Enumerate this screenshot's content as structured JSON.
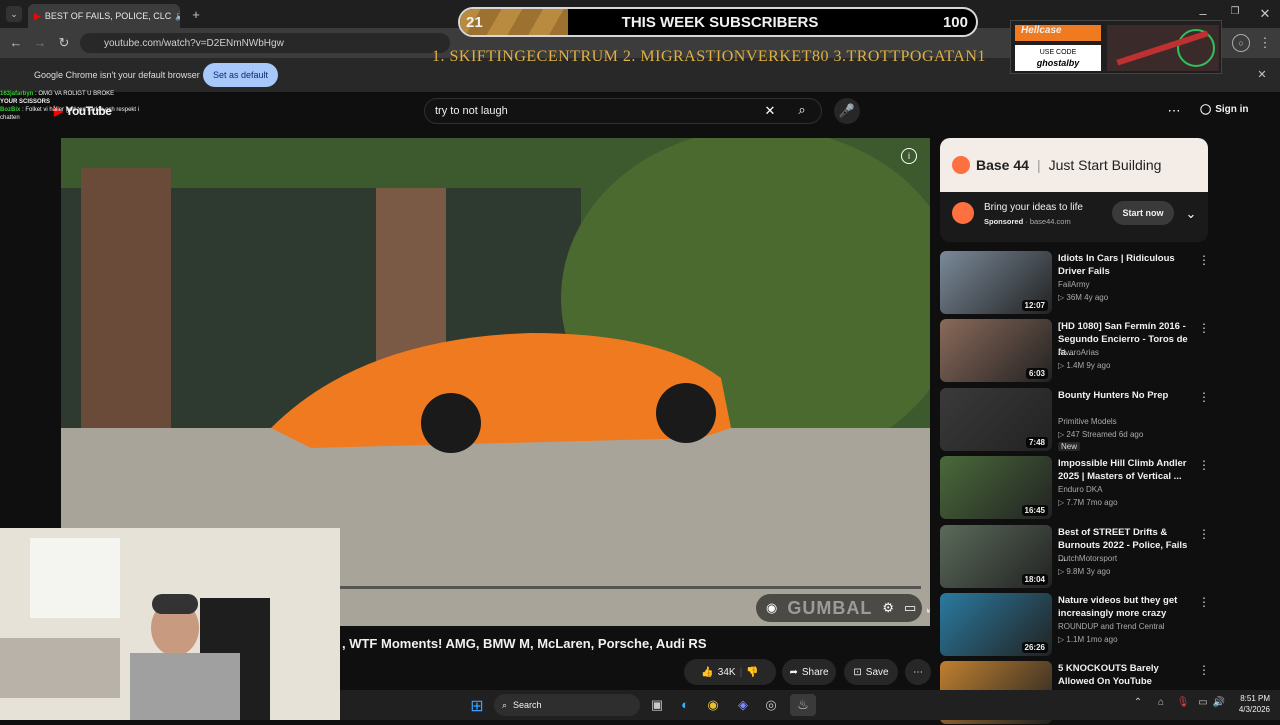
{
  "browser": {
    "tab_title": "BEST OF FAILS, POLICE, CLC",
    "url": "youtube.com/watch?v=D2ENmNWbHgw",
    "default_msg": "Google Chrome isn't your default browser",
    "set_default": "Set as default"
  },
  "youtube": {
    "logo": "YouTube",
    "search_value": "try to not laugh",
    "sign_in": "Sign in",
    "video_title": ", WTF Moments! AMG, BMW M, McLaren, Porsche, Audi RS",
    "likes": "34K",
    "share": "Share",
    "save": "Save",
    "watermark": "GUMBAL"
  },
  "ad": {
    "brand": "Base 44",
    "tagline": "Just Start Building",
    "headline": "Bring your ideas to life",
    "sponsored": "Sponsored",
    "domain": "base44.com",
    "cta": "Start now"
  },
  "recs": [
    {
      "title": "Idiots In Cars | Ridiculous Driver Fails",
      "channel": "FailArmy",
      "meta": "36M  4y ago",
      "dur": "12:07",
      "color": "#7a8a9a",
      "badge": ""
    },
    {
      "title": "[HD 1080] San Fermín 2016 - Segundo Encierro - Toros de la...",
      "channel": "ÁlvaroArias",
      "meta": "1.4M  9y ago",
      "dur": "6:03",
      "color": "#8a6a5a",
      "badge": ""
    },
    {
      "title": "Bounty Hunters No Prep",
      "channel": "Primitive Models",
      "meta": "247  Streamed 6d ago",
      "dur": "7:48",
      "color": "#3a3a3a",
      "badge": "New"
    },
    {
      "title": "Impossible Hill Climb Andler 2025 | Masters of Vertical ...",
      "channel": "Enduro DKA",
      "meta": "7.7M  7mo ago",
      "dur": "16:45",
      "color": "#4a6a3a",
      "badge": ""
    },
    {
      "title": "Best of STREET Drifts & Burnouts 2022 - Police, Fails ...",
      "channel": "DutchMotorsport",
      "meta": "9.8M  3y ago",
      "dur": "18:04",
      "color": "#5a6a5a",
      "badge": ""
    },
    {
      "title": "Nature videos but they get increasingly more crazy",
      "channel": "ROUNDUP and Trend Central",
      "meta": "1.1M  1mo ago",
      "dur": "26:26",
      "color": "#2a7aa0",
      "badge": ""
    },
    {
      "title": "5 KNOCKOUTS Barely Allowed On YouTube",
      "channel": "",
      "meta": "",
      "dur": "",
      "color": "#c08030",
      "badge": ""
    }
  ],
  "overlay": {
    "sub_current": "21",
    "sub_label": "THIS WEEK SUBSCRIBERS",
    "sub_goal": "100",
    "sub_fraction": 0.21,
    "top_subs": "1. SKIFTINGECENTRUM  2. MIGRASTIONVERKET80 3.TROTTPOGATAN1",
    "hellcase_brand": "Hellcase",
    "use_code": "USE CODE",
    "code": "ghostalby"
  },
  "chat": [
    {
      "user": "163jafarbyn",
      "msg": "OMG VA ROLIGT U BROKE"
    },
    {
      "user": "",
      "msg": "YOUR SCISSORS"
    },
    {
      "user": "BozBix",
      "msg": "Folket vi håller god ton kärlek och respekt i chatten"
    }
  ],
  "taskbar": {
    "search": "Search",
    "time": "8:51 PM",
    "date": "4/3/2026"
  }
}
